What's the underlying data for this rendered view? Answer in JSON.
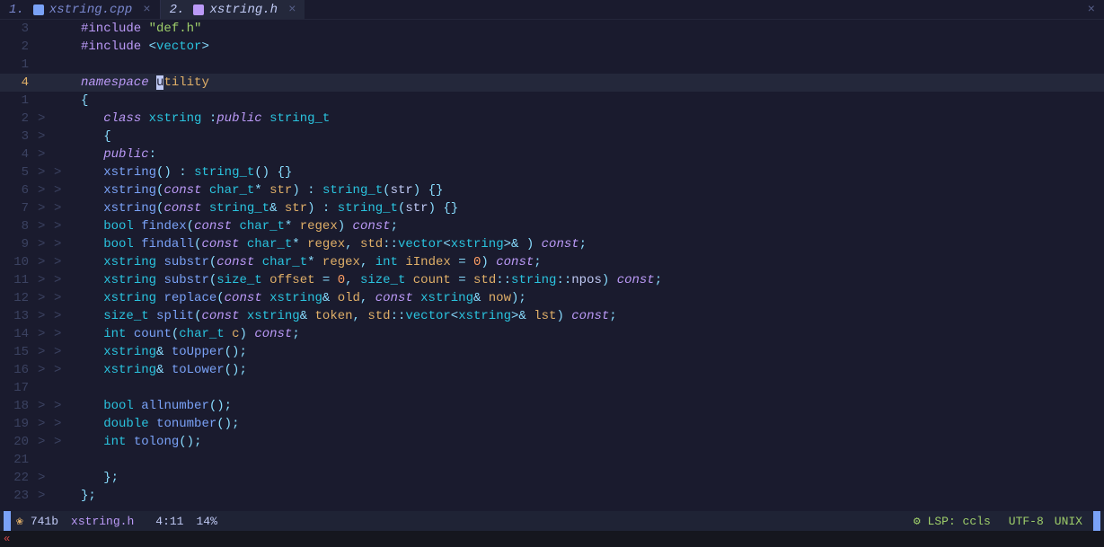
{
  "tabs": [
    {
      "num": "1.",
      "icon_color": "#7aa2f7",
      "name": "xstring.cpp",
      "active": false
    },
    {
      "num": "2.",
      "icon_color": "#bb9af7",
      "name": "xstring.h",
      "active": true
    }
  ],
  "tab_close_glyph": "×",
  "tabbar_close_glyph": "×",
  "lines": [
    {
      "g": "3",
      "f": "",
      "f2": "",
      "html": "<span class='prep'>#include</span> <span class='str'>\"def.h\"</span>"
    },
    {
      "g": "2",
      "f": "",
      "f2": "",
      "html": "<span class='prep'>#include</span> <span class='angle'>&lt;</span><span class='type'>vector</span><span class='angle'>&gt;</span>"
    },
    {
      "g": "1",
      "f": "",
      "f2": "",
      "html": ""
    },
    {
      "g": "4",
      "gcur": true,
      "f": "",
      "f2": "",
      "hl": true,
      "html": "<span class='kw'>namespace</span> <span class='cursor-mark'>u</span><span class='ns'>tility</span>"
    },
    {
      "g": "1",
      "f": "",
      "f2": "",
      "html": "<span class='punc'>{</span>"
    },
    {
      "g": "2",
      "f": ">",
      "f2": "",
      "html": "   <span class='kw'>class</span> <span class='type'>xstring</span> <span class='punc'>:</span><span class='kw'>public</span> <span class='type'>string_t</span>"
    },
    {
      "g": "3",
      "f": ">",
      "f2": "",
      "html": "   <span class='punc'>{</span>"
    },
    {
      "g": "4",
      "f": ">",
      "f2": "",
      "html": "   <span class='kw'>public</span><span class='punc'>:</span>"
    },
    {
      "g": "5",
      "f": ">",
      "f2": ">",
      "html": "   <span class='fn'>xstring</span><span class='punc'>()</span> <span class='punc'>:</span> <span class='type'>string_t</span><span class='punc'>()</span> <span class='punc'>{}</span>"
    },
    {
      "g": "6",
      "f": ">",
      "f2": ">",
      "html": "   <span class='fn'>xstring</span><span class='punc'>(</span><span class='const'>const</span> <span class='type'>char_t</span><span class='op'>*</span> <span class='param'>str</span><span class='punc'>)</span> <span class='punc'>:</span> <span class='type'>string_t</span><span class='punc'>(</span><span class='var'>str</span><span class='punc'>)</span> <span class='punc'>{}</span>"
    },
    {
      "g": "7",
      "f": ">",
      "f2": ">",
      "html": "   <span class='fn'>xstring</span><span class='punc'>(</span><span class='const'>const</span> <span class='type'>string_t</span><span class='op'>&amp;</span> <span class='param'>str</span><span class='punc'>)</span> <span class='punc'>:</span> <span class='type'>string_t</span><span class='punc'>(</span><span class='var'>str</span><span class='punc'>)</span> <span class='punc'>{}</span>"
    },
    {
      "g": "8",
      "f": ">",
      "f2": ">",
      "html": "   <span class='type'>bool</span> <span class='fn'>findex</span><span class='punc'>(</span><span class='const'>const</span> <span class='type'>char_t</span><span class='op'>*</span> <span class='param'>regex</span><span class='punc'>)</span> <span class='const'>const</span><span class='punc'>;</span>"
    },
    {
      "g": "9",
      "f": ">",
      "f2": ">",
      "html": "   <span class='type'>bool</span> <span class='fn'>findall</span><span class='punc'>(</span><span class='const'>const</span> <span class='type'>char_t</span><span class='op'>*</span> <span class='param'>regex</span><span class='punc'>,</span> <span class='ns'>std</span><span class='punc'>::</span><span class='type'>vector</span><span class='angle'>&lt;</span><span class='type'>xstring</span><span class='angle'>&gt;</span><span class='op'>&amp;</span> <span class='punc'>)</span> <span class='const'>const</span><span class='punc'>;</span>"
    },
    {
      "g": "10",
      "f": ">",
      "f2": ">",
      "html": "   <span class='type'>xstring</span> <span class='fn'>substr</span><span class='punc'>(</span><span class='const'>const</span> <span class='type'>char_t</span><span class='op'>*</span> <span class='param'>regex</span><span class='punc'>,</span> <span class='type'>int</span> <span class='param'>iIndex</span> <span class='op'>=</span> <span class='num'>0</span><span class='punc'>)</span> <span class='const'>const</span><span class='punc'>;</span>"
    },
    {
      "g": "11",
      "f": ">",
      "f2": ">",
      "html": "   <span class='type'>xstring</span> <span class='fn'>substr</span><span class='punc'>(</span><span class='type'>size_t</span> <span class='param'>offset</span> <span class='op'>=</span> <span class='num'>0</span><span class='punc'>,</span> <span class='type'>size_t</span> <span class='param'>count</span> <span class='op'>=</span> <span class='ns'>std</span><span class='punc'>::</span><span class='type'>string</span><span class='punc'>::</span><span class='var'>npos</span><span class='punc'>)</span> <span class='const'>const</span><span class='punc'>;</span>"
    },
    {
      "g": "12",
      "f": ">",
      "f2": ">",
      "html": "   <span class='type'>xstring</span> <span class='fn'>replace</span><span class='punc'>(</span><span class='const'>const</span> <span class='type'>xstring</span><span class='op'>&amp;</span> <span class='param'>old</span><span class='punc'>,</span> <span class='const'>const</span> <span class='type'>xstring</span><span class='op'>&amp;</span> <span class='param'>now</span><span class='punc'>);</span>"
    },
    {
      "g": "13",
      "f": ">",
      "f2": ">",
      "html": "   <span class='type'>size_t</span> <span class='fn'>split</span><span class='punc'>(</span><span class='const'>const</span> <span class='type'>xstring</span><span class='op'>&amp;</span> <span class='param'>token</span><span class='punc'>,</span> <span class='ns'>std</span><span class='punc'>::</span><span class='type'>vector</span><span class='angle'>&lt;</span><span class='type'>xstring</span><span class='angle'>&gt;</span><span class='op'>&amp;</span> <span class='param'>lst</span><span class='punc'>)</span> <span class='const'>const</span><span class='punc'>;</span>"
    },
    {
      "g": "14",
      "f": ">",
      "f2": ">",
      "html": "   <span class='type'>int</span> <span class='fn'>count</span><span class='punc'>(</span><span class='type'>char_t</span> <span class='param'>c</span><span class='punc'>)</span> <span class='const'>const</span><span class='punc'>;</span>"
    },
    {
      "g": "15",
      "f": ">",
      "f2": ">",
      "html": "   <span class='type'>xstring</span><span class='op'>&amp;</span> <span class='fn'>toUpper</span><span class='punc'>();</span>"
    },
    {
      "g": "16",
      "f": ">",
      "f2": ">",
      "html": "   <span class='type'>xstring</span><span class='op'>&amp;</span> <span class='fn'>toLower</span><span class='punc'>();</span>"
    },
    {
      "g": "17",
      "f": "",
      "f2": "",
      "html": ""
    },
    {
      "g": "18",
      "f": ">",
      "f2": ">",
      "html": "   <span class='type'>bool</span> <span class='fn'>allnumber</span><span class='punc'>();</span>"
    },
    {
      "g": "19",
      "f": ">",
      "f2": ">",
      "html": "   <span class='type'>double</span> <span class='fn'>tonumber</span><span class='punc'>();</span>"
    },
    {
      "g": "20",
      "f": ">",
      "f2": ">",
      "html": "   <span class='type'>int</span> <span class='fn'>tolong</span><span class='punc'>();</span>"
    },
    {
      "g": "21",
      "f": "",
      "f2": "",
      "html": ""
    },
    {
      "g": "22",
      "f": ">",
      "f2": "",
      "html": "   <span class='punc'>};</span>"
    },
    {
      "g": "23",
      "f": ">",
      "f2": "",
      "html": "<span class='punc'>};</span>"
    }
  ],
  "status": {
    "icon": "❀",
    "size": "741b",
    "file": "xstring.h",
    "pos": "4:11",
    "pct": "14%",
    "lsp": "⚙ LSP: ccls",
    "encoding": "UTF-8",
    "fileformat": "UNIX"
  },
  "cmdline": "«"
}
